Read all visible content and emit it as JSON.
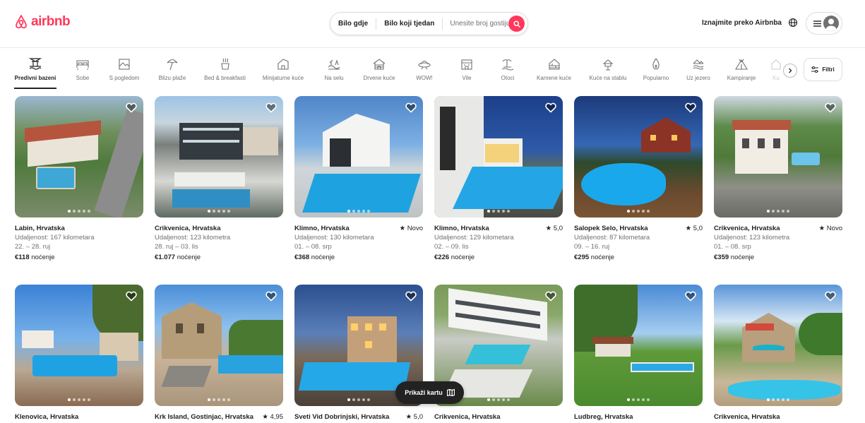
{
  "header": {
    "logo_text": "airbnb",
    "search": {
      "where": "Bilo gdje",
      "when": "Bilo koji tjedan",
      "guests_placeholder": "Unesite broj gostiju"
    },
    "host_link": "Iznajmite preko Airbnba"
  },
  "categories": [
    {
      "label": "Predivni bazeni",
      "icon": "pool-icon",
      "active": true
    },
    {
      "label": "Sobe",
      "icon": "bed-icon"
    },
    {
      "label": "S pogledom",
      "icon": "view-icon"
    },
    {
      "label": "Blizu plaže",
      "icon": "beach-umbrella-icon"
    },
    {
      "label": "Bed & breakfasti",
      "icon": "breakfast-icon"
    },
    {
      "label": "Minijaturne kuće",
      "icon": "tiny-house-icon"
    },
    {
      "label": "Na selu",
      "icon": "countryside-icon"
    },
    {
      "label": "Drvene kuće",
      "icon": "cabin-icon"
    },
    {
      "label": "WOW!",
      "icon": "ufo-icon"
    },
    {
      "label": "Vile",
      "icon": "villa-icon"
    },
    {
      "label": "Otoci",
      "icon": "island-icon"
    },
    {
      "label": "Kamene kuće",
      "icon": "stone-house-icon"
    },
    {
      "label": "Kuće na stablu",
      "icon": "treehouse-icon"
    },
    {
      "label": "Popularno",
      "icon": "flame-icon"
    },
    {
      "label": "Uz jezero",
      "icon": "lake-icon"
    },
    {
      "label": "Kampiranje",
      "icon": "tent-icon"
    },
    {
      "label": "Ku",
      "icon": "house-icon"
    }
  ],
  "filters_label": "Filtri",
  "price_suffix": "noćenje",
  "listings": [
    {
      "title": "Labin, Hrvatska",
      "rating": "",
      "distance": "Udaljenost: 167 kilometara",
      "dates": "22. – 28. ruj",
      "price": "€118"
    },
    {
      "title": "Crikvenica, Hrvatska",
      "rating": "",
      "distance": "Udaljenost: 123 kilometra",
      "dates": "28. ruj – 03. lis",
      "price": "€1.077"
    },
    {
      "title": "Klimno, Hrvatska",
      "rating": "★ Novo",
      "distance": "Udaljenost: 130 kilometara",
      "dates": "01. – 08. srp",
      "price": "€368"
    },
    {
      "title": "Klimno, Hrvatska",
      "rating": "★ 5,0",
      "distance": "Udaljenost: 129 kilometara",
      "dates": "02. – 09. lis",
      "price": "€226"
    },
    {
      "title": "Salopek Selo, Hrvatska",
      "rating": "★ 5,0",
      "distance": "Udaljenost: 87 kilometara",
      "dates": "09. – 16. ruj",
      "price": "€295"
    },
    {
      "title": "Crikvenica, Hrvatska",
      "rating": "★ Novo",
      "distance": "Udaljenost: 123 kilometra",
      "dates": "01. – 08. srp",
      "price": "€359"
    },
    {
      "title": "Klenovica, Hrvatska",
      "rating": ""
    },
    {
      "title": "Krk Island, Gostinjac, Hrvatska",
      "rating": "★ 4,95"
    },
    {
      "title": "Sveti Vid Dobrinjski, Hrvatska",
      "rating": "★ 5,0"
    },
    {
      "title": "Crikvenica, Hrvatska",
      "rating": ""
    },
    {
      "title": "Ludbreg, Hrvatska",
      "rating": ""
    },
    {
      "title": "Crikvenica, Hrvatska",
      "rating": ""
    }
  ],
  "map_button": "Prikaži kartu"
}
